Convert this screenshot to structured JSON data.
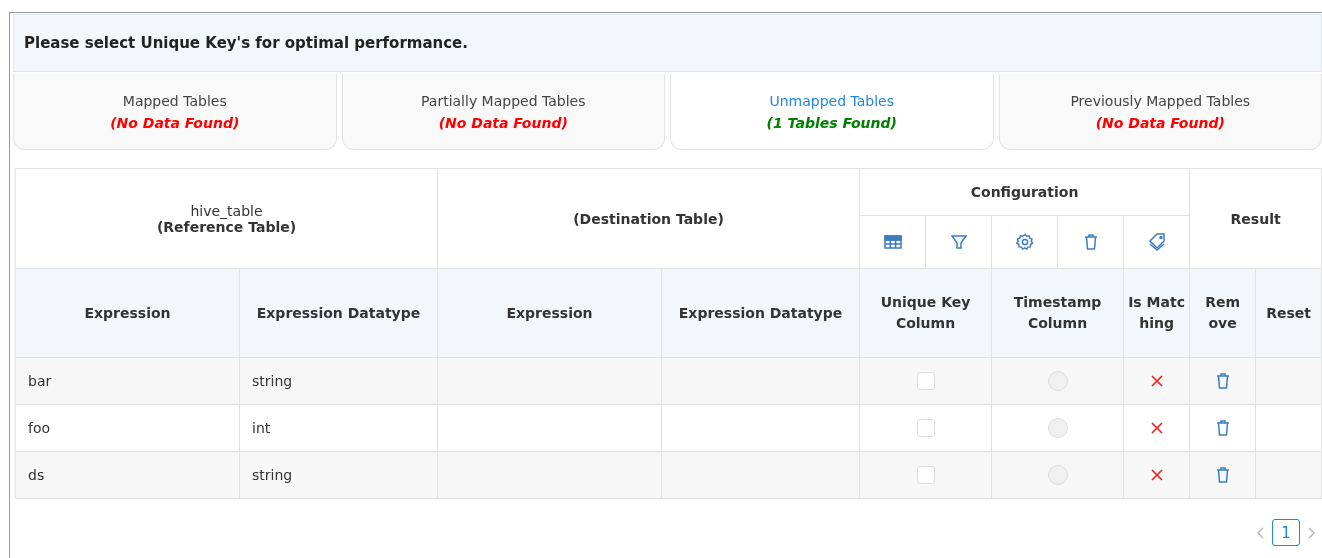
{
  "banner": {
    "text": "Please select Unique Key's for optimal performance."
  },
  "tabs": [
    {
      "label": "Mapped Tables",
      "status": "(No Data Found)",
      "color": "#ff0000",
      "selected": false
    },
    {
      "label": "Partially Mapped Tables",
      "status": "(No Data Found)",
      "color": "#ff0000",
      "selected": false
    },
    {
      "label": "Unmapped Tables",
      "status": "(1 Tables Found)",
      "color": "#008000",
      "selected": true
    },
    {
      "label": "Previously Mapped Tables",
      "status": "(No Data Found)",
      "color": "#ff0000",
      "selected": false
    }
  ],
  "table": {
    "reference": {
      "name": "hive_table",
      "caption": "(Reference Table)"
    },
    "destination": {
      "caption": "(Destination Table)"
    },
    "configuration": {
      "title": "Configuration",
      "icons": [
        {
          "kind": "table"
        },
        {
          "kind": "filter"
        },
        {
          "kind": "settings"
        },
        {
          "kind": "trash"
        },
        {
          "kind": "tags"
        }
      ]
    },
    "result": {
      "title": "Result"
    },
    "columns": [
      "Expression",
      "Expression Datatype",
      "Expression",
      "Expression Datatype",
      "Unique Key Column",
      "Timestamp Column",
      "Is Matc hing",
      "Rem ove",
      "Reset"
    ],
    "rows": [
      {
        "expression": "bar",
        "datatype": "string",
        "unique_key": false,
        "timestamp": false,
        "matching": false
      },
      {
        "expression": "foo",
        "datatype": "int",
        "unique_key": false,
        "timestamp": false,
        "matching": false
      },
      {
        "expression": "ds",
        "datatype": "string",
        "unique_key": false,
        "timestamp": false,
        "matching": false
      }
    ]
  },
  "pagination": {
    "pages": [
      {
        "label": "1",
        "selected": true
      }
    ]
  }
}
